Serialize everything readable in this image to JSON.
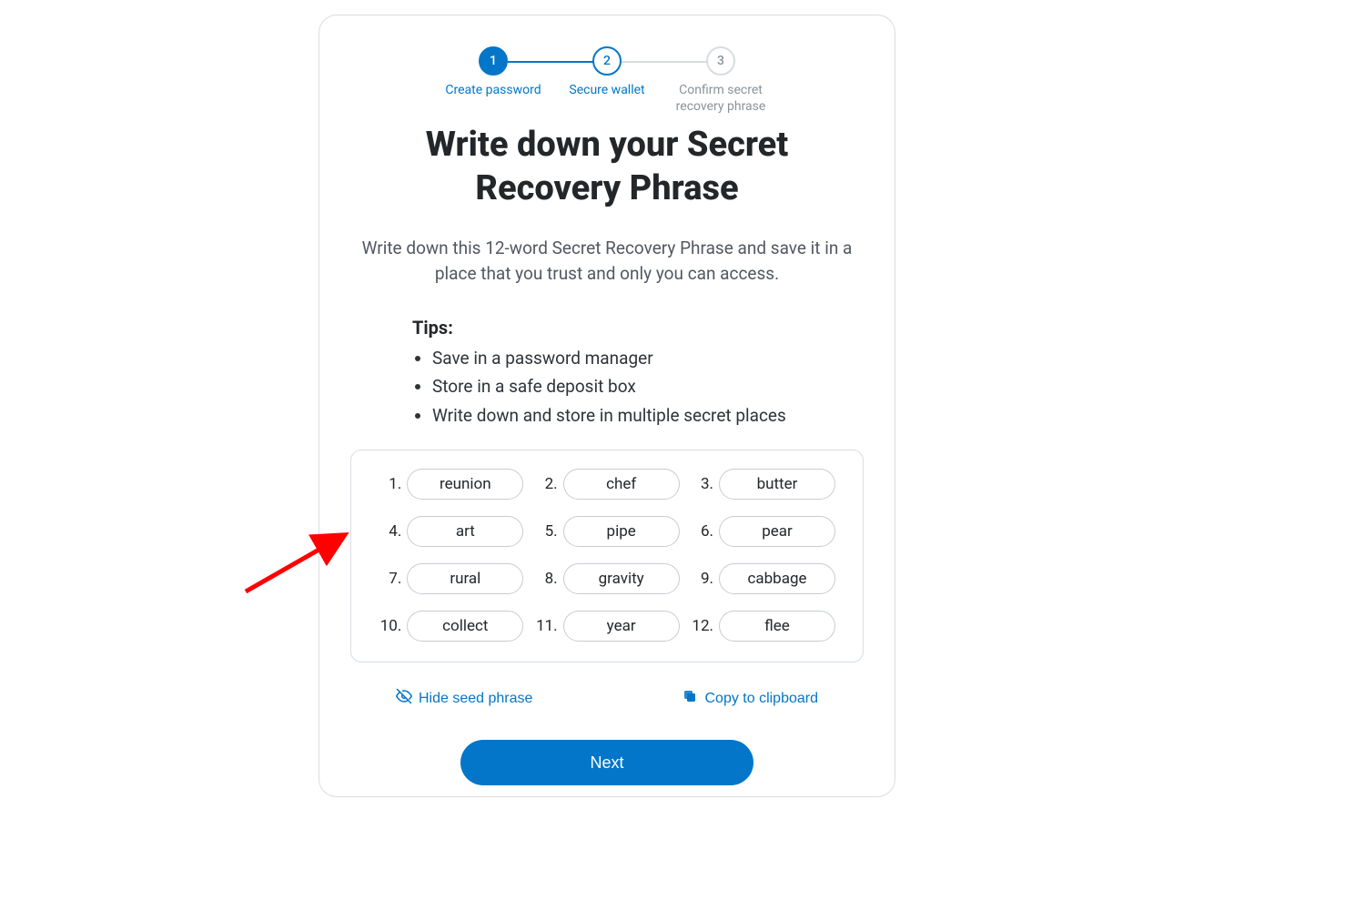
{
  "stepper": {
    "steps": [
      {
        "number": "1",
        "label": "Create password"
      },
      {
        "number": "2",
        "label": "Secure wallet"
      },
      {
        "number": "3",
        "label": "Confirm secret recovery phrase"
      }
    ]
  },
  "heading": "Write down your Secret Recovery Phrase",
  "description": "Write down this 12-word Secret Recovery Phrase and save it in a place that you trust and only you can access.",
  "tips": {
    "heading": "Tips:",
    "items": [
      "Save in a password manager",
      "Store in a safe deposit box",
      "Write down and store in multiple secret places"
    ]
  },
  "phrase": [
    "reunion",
    "chef",
    "butter",
    "art",
    "pipe",
    "pear",
    "rural",
    "gravity",
    "cabbage",
    "collect",
    "year",
    "flee"
  ],
  "actions": {
    "hide_label": "Hide seed phrase",
    "copy_label": "Copy to clipboard"
  },
  "next_label": "Next"
}
